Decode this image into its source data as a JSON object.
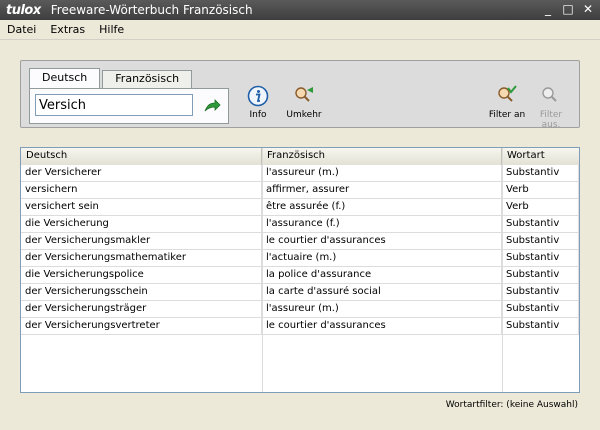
{
  "window": {
    "logo": "tulox",
    "title": "Freeware-Wörterbuch Französisch",
    "minimize": "_",
    "maximize": "□",
    "close": "✕"
  },
  "menu": [
    {
      "label": "Datei"
    },
    {
      "label": "Extras"
    },
    {
      "label": "Hilfe"
    }
  ],
  "tabs": {
    "active": "Deutsch",
    "inactive": "Französisch"
  },
  "search": {
    "value": "Versich"
  },
  "toolbar": {
    "info_label": "Info",
    "umkehr_label": "Umkehr",
    "filter_an_label": "Filter an",
    "filter_aus_label": "Filter aus.",
    "accent_green": "#2e9a3a",
    "info_blue": "#1f5fa8"
  },
  "table": {
    "headers": [
      "Deutsch",
      "Französisch",
      "Wortart"
    ],
    "rows": [
      [
        "der Versicherer",
        "l'assureur (m.)",
        "Substantiv"
      ],
      [
        "versichern",
        "affirmer, assurer",
        "Verb"
      ],
      [
        "versichert sein",
        "être assurée (f.)",
        "Verb"
      ],
      [
        "die Versicherung",
        "l'assurance (f.)",
        "Substantiv"
      ],
      [
        "der Versicherungsmakler",
        "le courtier d'assurances",
        "Substantiv"
      ],
      [
        "der Versicherungsmathematiker",
        "l'actuaire (m.)",
        "Substantiv"
      ],
      [
        "die Versicherungspolice",
        "la police d'assurance",
        "Substantiv"
      ],
      [
        "der Versicherungsschein",
        "la carte d'assuré social",
        "Substantiv"
      ],
      [
        "der Versicherungsträger",
        "l'assureur (m.)",
        "Substantiv"
      ],
      [
        "der Versicherungsvertreter",
        "le courtier d'assurances",
        "Substantiv"
      ]
    ]
  },
  "status": {
    "text": "Wortartfilter: (keine Auswahl)"
  }
}
